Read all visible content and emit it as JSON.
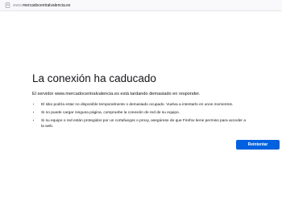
{
  "browser": {
    "url_prefix": "www.",
    "url_domain": "mercadocentralvalencia.es",
    "page_icon": "page-icon"
  },
  "error": {
    "title": "La conexión ha caducado",
    "description": "El servidor www.mercadocentralvalencia.es está tardando demasiado en responder.",
    "tips": [
      "El sitio podría estar no disponible temporalmente o demasiado ocupado. Vuelva a intentarlo en unos momentos.",
      "Si no puede cargar ninguna página, compruebe la conexión de red de su equipo.",
      "Si su equipo o red están protegidos por un cortafuegos o proxy, asegúrese de que Firefox tiene permiso para acceder a la web."
    ],
    "retry_label": "Reintentar"
  },
  "colors": {
    "accent": "#0061e0",
    "text": "#15141a"
  }
}
